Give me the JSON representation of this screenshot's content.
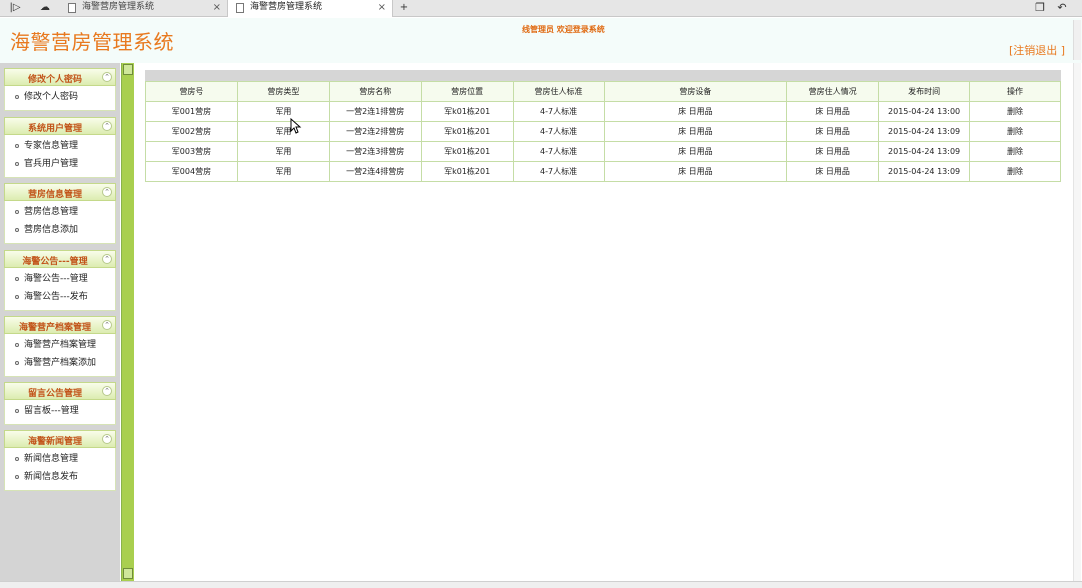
{
  "browser": {
    "tabs": [
      {
        "label": "海警营房管理系统",
        "active": false
      },
      {
        "label": "海警营房管理系统",
        "active": true
      }
    ],
    "close_glyph": "×",
    "new_tab_glyph": "+",
    "icons": [
      "sidebar-toggle-icon",
      "cloud-icon",
      "restore-window-icon",
      "undo-icon"
    ]
  },
  "header": {
    "title": "海警营房管理系统",
    "welcome": "线管理员  欢迎登录系统",
    "logout": "[注销退出  ]"
  },
  "sidebar": {
    "toggle_glyph": "⌃",
    "groups": [
      {
        "title": "修改个人密码",
        "items": [
          "修改个人密码"
        ]
      },
      {
        "title": "系统用户管理",
        "items": [
          "专家信息管理",
          "官兵用户管理"
        ]
      },
      {
        "title": "营房信息管理",
        "items": [
          "营房信息管理",
          "营房信息添加"
        ]
      },
      {
        "title": "海警公告---管理",
        "items": [
          "海警公告---管理",
          "海警公告---发布"
        ]
      },
      {
        "title": "海警营产档案管理",
        "items": [
          "海警营产档案管理",
          "海警营产档案添加"
        ]
      },
      {
        "title": "留言公告管理",
        "items": [
          "留言板---管理"
        ]
      },
      {
        "title": "海警新闻管理",
        "items": [
          "新闻信息管理",
          "新闻信息发布"
        ]
      }
    ]
  },
  "table": {
    "headers": [
      "营房号",
      "营房类型",
      "营房名称",
      "营房位置",
      "营房住人标准",
      "营房设备",
      "营房住人情况",
      "发布时间",
      "操作"
    ],
    "rows": [
      [
        "军001营房",
        "军用",
        "一营2连1排营房",
        "军k01栋201",
        "4-7人标准",
        "床  日用品",
        "床  日用品",
        "2015-04-24 13:00",
        "删除"
      ],
      [
        "军002营房",
        "军用",
        "一营2连2排营房",
        "军k01栋201",
        "4-7人标准",
        "床  日用品",
        "床  日用品",
        "2015-04-24 13:09",
        "删除"
      ],
      [
        "军003营房",
        "军用",
        "一营2连3排营房",
        "军k01栋201",
        "4-7人标准",
        "床  日用品",
        "床  日用品",
        "2015-04-24 13:09",
        "删除"
      ],
      [
        "军004营房",
        "军用",
        "一营2连4排营房",
        "军k01栋201",
        "4-7人标准",
        "床  日用品",
        "床  日用品",
        "2015-04-24 13:09",
        "删除"
      ]
    ]
  },
  "colors": {
    "accent_orange": "#e8791f",
    "sidebar_green": "#a9cf4f",
    "header_bg": "#f4fcfa"
  }
}
